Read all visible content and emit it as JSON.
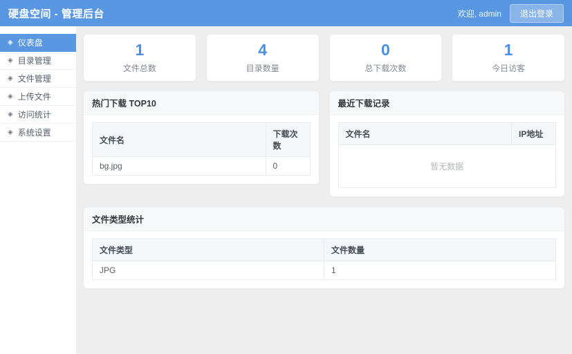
{
  "colors": {
    "header_bg": "#5a97e2",
    "accent": "#4a90e2",
    "content_bg": "#eeeeee"
  },
  "header": {
    "title": "硬盘空间 - 管理后台",
    "welcome": "欢迎, admin",
    "logout_label": "退出登录"
  },
  "sidebar": {
    "items": [
      {
        "id": "dashboard",
        "icon": "◈",
        "label": "仪表盘",
        "active": true
      },
      {
        "id": "directory-management",
        "icon": "◈",
        "label": "目录管理",
        "active": false
      },
      {
        "id": "file-management",
        "icon": "◈",
        "label": "文件管理",
        "active": false
      },
      {
        "id": "upload-file",
        "icon": "◈",
        "label": "上传文件",
        "active": false
      },
      {
        "id": "visit-statistics",
        "icon": "◈",
        "label": "访问统计",
        "active": false
      },
      {
        "id": "system-settings",
        "icon": "◈",
        "label": "系统设置",
        "active": false
      }
    ]
  },
  "stats": [
    {
      "id": "total-files",
      "value": "1",
      "label": "文件总数"
    },
    {
      "id": "directory-count",
      "value": "4",
      "label": "目录数量"
    },
    {
      "id": "total-downloads",
      "value": "0",
      "label": "总下载次数"
    },
    {
      "id": "today-visitors",
      "value": "1",
      "label": "今日访客"
    }
  ],
  "panels": {
    "hot_downloads": {
      "title": "热门下载 TOP10",
      "columns": [
        "文件名",
        "下载次数"
      ],
      "rows": [
        [
          "bg.jpg",
          "0"
        ]
      ],
      "empty_text": "暂无数据"
    },
    "recent_downloads": {
      "title": "最近下载记录",
      "columns": [
        "文件名",
        "IP地址"
      ],
      "rows": [],
      "empty_text": "暂无数据"
    },
    "file_types": {
      "title": "文件类型统计",
      "columns": [
        "文件类型",
        "文件数量"
      ],
      "rows": [
        [
          "JPG",
          "1"
        ]
      ],
      "empty_text": "暂无数据"
    }
  }
}
